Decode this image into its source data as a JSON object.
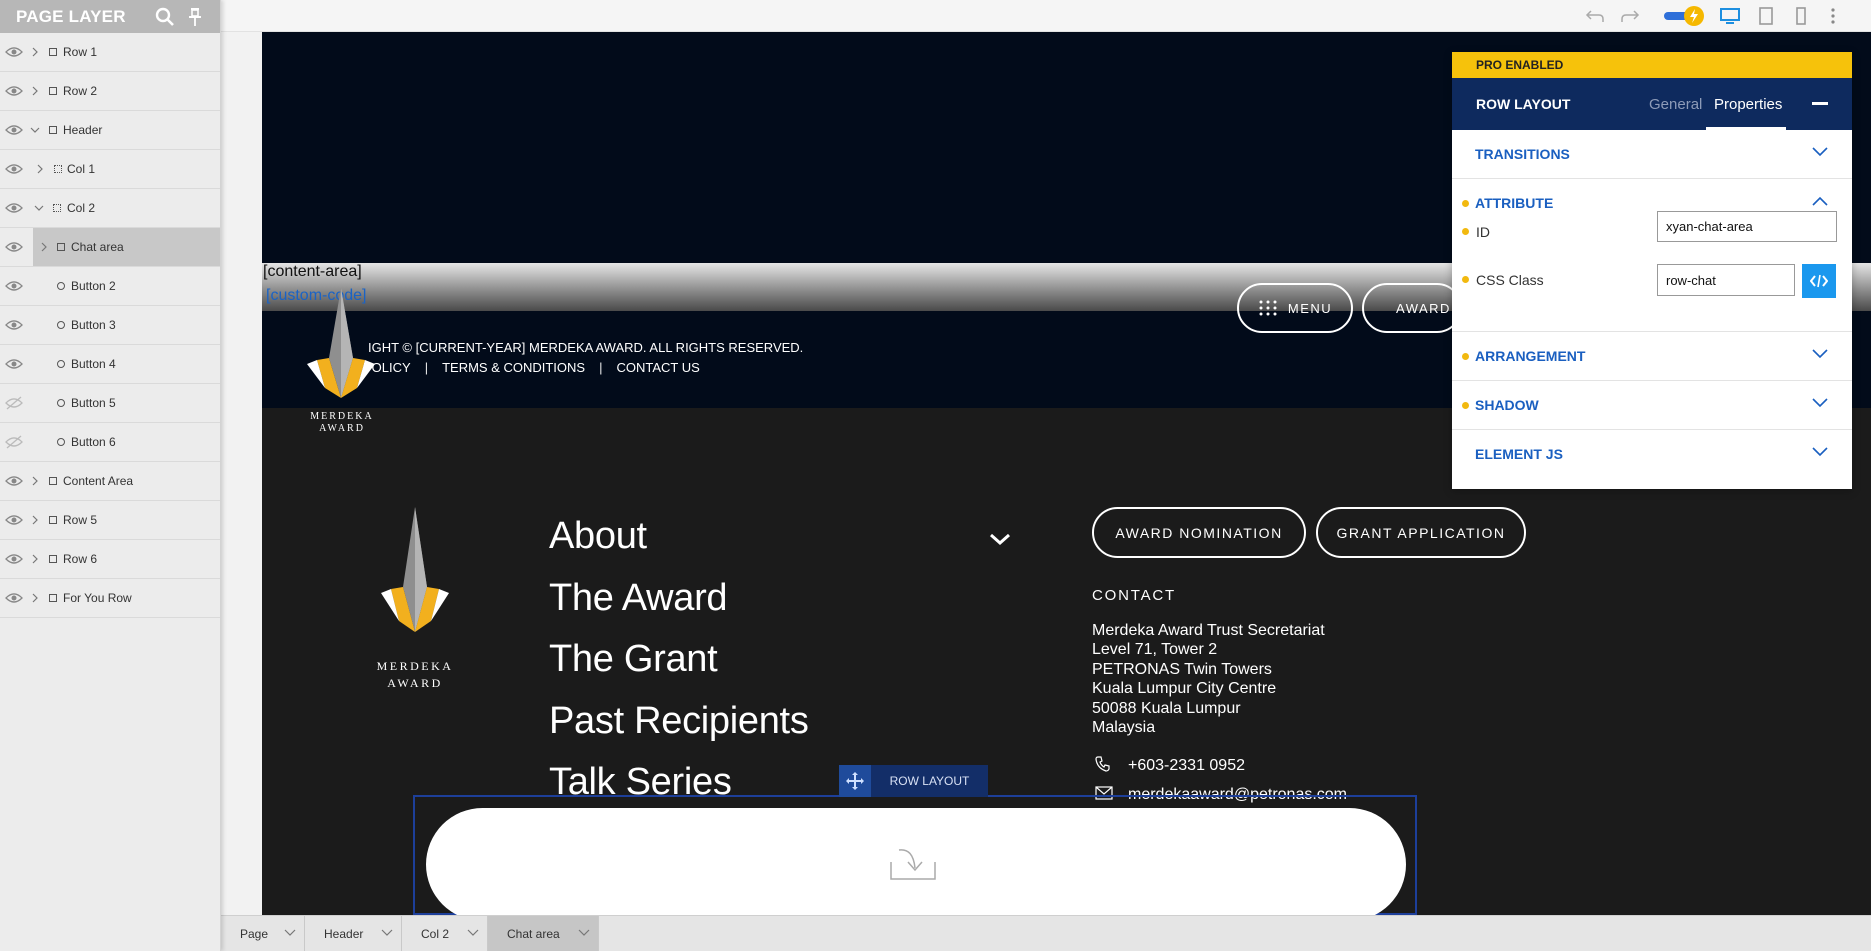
{
  "page_layer": {
    "title": "PAGE LAYER",
    "items": [
      {
        "label": "Row 1"
      },
      {
        "label": "Row 2"
      },
      {
        "label": "Header"
      },
      {
        "label": "Col 1"
      },
      {
        "label": "Col 2"
      },
      {
        "label": "Chat area"
      },
      {
        "label": "Button 2"
      },
      {
        "label": "Button 3"
      },
      {
        "label": "Button 4"
      },
      {
        "label": "Button 5"
      },
      {
        "label": "Button 6"
      },
      {
        "label": "Content Area"
      },
      {
        "label": "Row 5"
      },
      {
        "label": "Row 6"
      },
      {
        "label": "For You Row"
      }
    ]
  },
  "canvas": {
    "content_area_tag": "[content-area]",
    "custom_code_tag": "[custom-code]",
    "menu_label": "MENU",
    "award_label": "AWARD",
    "copyright": "IGHT © [CURRENT-YEAR] MERDEKA AWARD. ALL RIGHTS RESERVED.",
    "links": [
      "POLICY",
      "TERMS & CONDITIONS",
      "CONTACT US"
    ],
    "logo_line1": "MERDEKA",
    "logo_line2": "AWARD",
    "nav_links": [
      "About",
      "The Award",
      "The Grant",
      "Past Recipients",
      "Talk Series"
    ],
    "buttons": {
      "nomination": "AWARD NOMINATION",
      "grant": "GRANT APPLICATION"
    },
    "contact_heading": "CONTACT",
    "address": [
      "Merdeka Award Trust Secretariat",
      "Level 71, Tower 2",
      "PETRONAS Twin Towers",
      "Kuala Lumpur City Centre",
      "50088 Kuala Lumpur",
      "Malaysia"
    ],
    "phone": "+603-2331 0952",
    "email": "merdekaaward@petronas.com",
    "row_tag_label": "ROW LAYOUT"
  },
  "properties_panel": {
    "pro_label": "PRO ENABLED",
    "title": "ROW LAYOUT",
    "tabs": {
      "general": "General",
      "properties": "Properties"
    },
    "sections": {
      "transitions": "TRANSITIONS",
      "attribute": "ATTRIBUTE",
      "arrangement": "ARRANGEMENT",
      "shadow": "SHADOW",
      "element_js": "ELEMENT JS"
    },
    "fields": {
      "id_label": "ID",
      "id_value": "xyan-chat-area",
      "css_label": "CSS Class",
      "css_value": "row-chat"
    }
  },
  "breadcrumb": [
    "Page",
    "Header",
    "Col 2",
    "Chat area"
  ],
  "colors": {
    "accent": "#1a5fc0",
    "pro": "#f6c20b",
    "header": "#0e2a5e",
    "logo_gold": "#f2b01e"
  }
}
